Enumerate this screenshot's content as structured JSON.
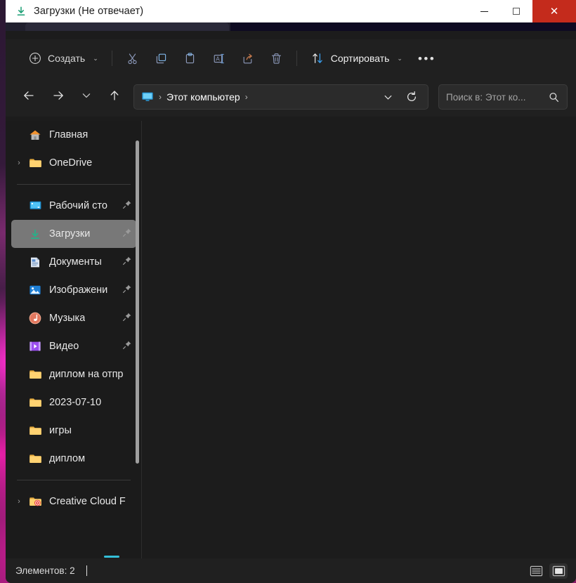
{
  "window": {
    "title": "Загрузки (Не отвечает)",
    "title_icon": "download-icon",
    "minimize_label": "—",
    "maximize_label": "□",
    "close_label": "✕",
    "close_bg": "#c42b1c"
  },
  "toolbar": {
    "new_label": "Создать",
    "new_icon": "plus-circle-icon",
    "cut_icon": "scissors-icon",
    "copy_icon": "copy-icon",
    "paste_icon": "paste-icon",
    "rename_icon": "rename-icon",
    "share_icon": "share-icon",
    "delete_icon": "trash-icon",
    "sort_label": "Сортировать",
    "sort_icon": "sort-arrows-icon",
    "more_label": "•••",
    "chevron": "⌄"
  },
  "navigation": {
    "back_icon": "arrow-left-icon",
    "forward_icon": "arrow-right-icon",
    "recent_icon": "chevron-down-icon",
    "up_icon": "arrow-up-icon",
    "refresh_icon": "refresh-icon",
    "dropdown_icon": "chevron-down-icon"
  },
  "breadcrumb": {
    "location_icon": "computer-icon",
    "sep1": "›",
    "path": "Этот компьютер",
    "sep2": "›"
  },
  "search": {
    "placeholder": "Поиск в: Этот ко...",
    "icon": "search-icon"
  },
  "sidebar": {
    "items": [
      {
        "label": "Главная",
        "icon": "home-icon",
        "expander": "",
        "pinned": false,
        "selected": false
      },
      {
        "label": "OneDrive",
        "icon": "onedrive-folder-icon",
        "expander": "›",
        "pinned": false,
        "selected": false
      },
      {
        "divider": true
      },
      {
        "label": "Рабочий сто",
        "icon": "desktop-icon",
        "expander": "",
        "pinned": true,
        "selected": false
      },
      {
        "label": "Загрузки",
        "icon": "download-icon",
        "expander": "",
        "pinned": true,
        "selected": true
      },
      {
        "label": "Документы",
        "icon": "documents-icon",
        "expander": "",
        "pinned": true,
        "selected": false
      },
      {
        "label": "Изображени",
        "icon": "pictures-icon",
        "expander": "",
        "pinned": true,
        "selected": false
      },
      {
        "label": "Музыка",
        "icon": "music-icon",
        "expander": "",
        "pinned": true,
        "selected": false
      },
      {
        "label": "Видео",
        "icon": "video-icon",
        "expander": "",
        "pinned": true,
        "selected": false
      },
      {
        "label": "диплом на отпр",
        "icon": "folder-icon",
        "expander": "",
        "pinned": false,
        "selected": false
      },
      {
        "label": "2023-07-10",
        "icon": "folder-icon",
        "expander": "",
        "pinned": false,
        "selected": false
      },
      {
        "label": "игры",
        "icon": "folder-icon",
        "expander": "",
        "pinned": false,
        "selected": false
      },
      {
        "label": "диплом",
        "icon": "folder-icon",
        "expander": "",
        "pinned": false,
        "selected": false
      },
      {
        "divider": true
      },
      {
        "label": "Creative Cloud F",
        "icon": "creative-cloud-folder-icon",
        "expander": "›",
        "pinned": false,
        "selected": false
      }
    ],
    "pin_icon": "pin-icon",
    "scrollbar": "vertical-scrollbar"
  },
  "statusbar": {
    "items_count_label": "Элементов: 2",
    "list_view_icon": "details-view-icon",
    "tiles_view_icon": "large-icons-view-icon"
  },
  "colors": {
    "accent_blue": "#4cc2ff",
    "window_bg": "#1c1c1c",
    "sidebar_bg": "#1b1b1b",
    "chrome_bg": "#202020",
    "selection": "#787878",
    "taskbar_accent": "#34bfd8"
  }
}
